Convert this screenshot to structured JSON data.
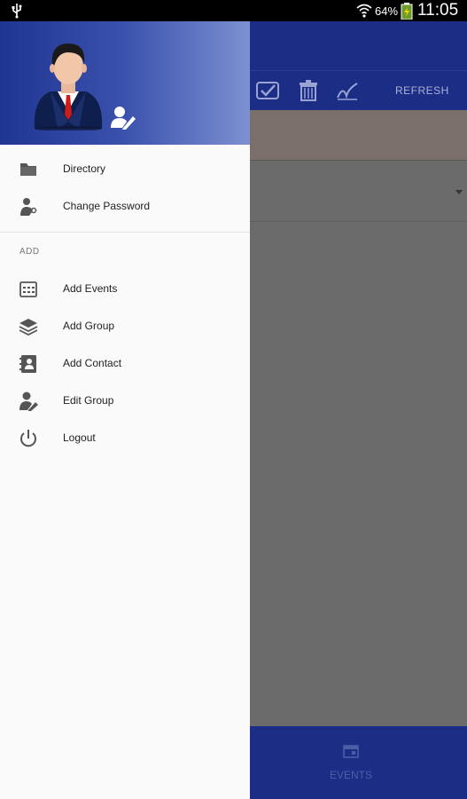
{
  "status_bar": {
    "battery_percent": "64%",
    "time": "11:05"
  },
  "toolbar": {
    "refresh_label": "REFRESH"
  },
  "bottom_nav": {
    "events_label": "EVENTS"
  },
  "drawer": {
    "items_top": [
      {
        "label": "Directory",
        "icon": "folder-icon"
      },
      {
        "label": "Change Password",
        "icon": "user-key-icon"
      }
    ],
    "section_title": "ADD",
    "items_add": [
      {
        "label": "Add Events",
        "icon": "calendar-icon"
      },
      {
        "label": "Add Group",
        "icon": "layers-icon"
      },
      {
        "label": "Add Contact",
        "icon": "contact-book-icon"
      },
      {
        "label": "Edit Group",
        "icon": "edit-user-icon"
      },
      {
        "label": "Logout",
        "icon": "power-icon"
      }
    ]
  },
  "colors": {
    "primary": "#1b2d84",
    "drawer_bg": "#fafafa",
    "scrim": "#6b6b6b"
  }
}
